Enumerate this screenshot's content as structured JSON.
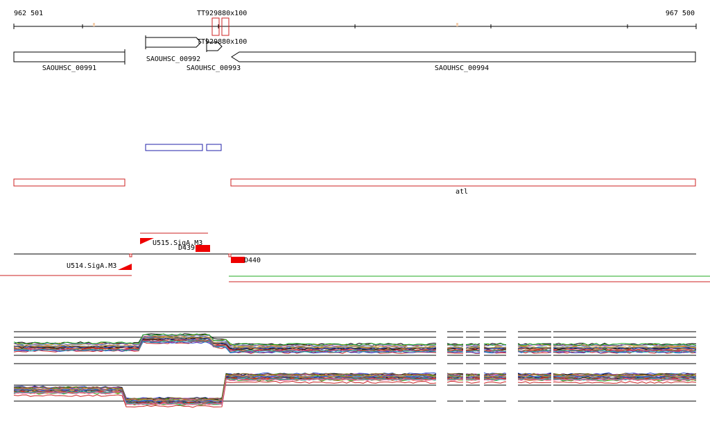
{
  "coordinates": {
    "start": "962 501",
    "end": "967 500"
  },
  "tss_markers": [
    "TT929880x100",
    "TT929880x100"
  ],
  "genes": [
    "SAOUHSC_00991",
    "SAOUHSC_00992",
    "SAOUHSC_00993",
    "SAOUHSC_00994"
  ],
  "annotation_track": {
    "gene_label": "atl"
  },
  "promoters": [
    "U514.SigA.M3",
    "U515.SigA.M3"
  ],
  "terminators": [
    "D439",
    "D440"
  ],
  "colors": {
    "gene_outline": "#000000",
    "blue_feature": "#2222aa",
    "red_feature": "#cc2222",
    "promoter_fill": "#ee0000",
    "green_track": "#22aa22"
  }
}
